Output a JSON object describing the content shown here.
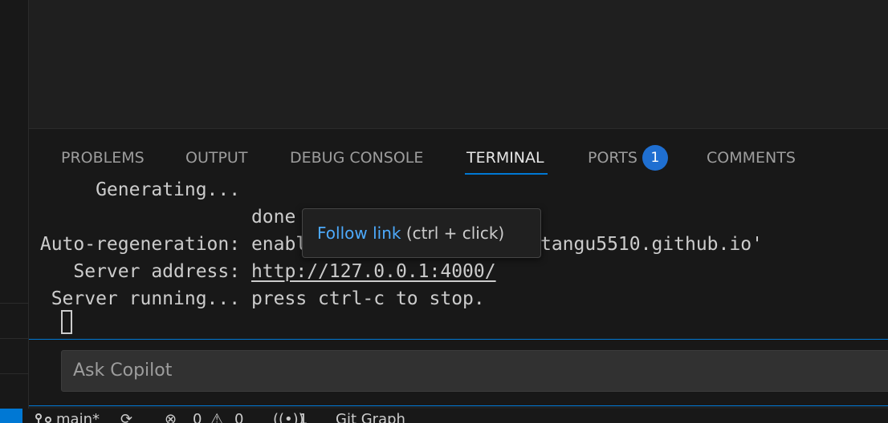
{
  "panel": {
    "tabs": [
      {
        "label": "PROBLEMS"
      },
      {
        "label": "OUTPUT"
      },
      {
        "label": "DEBUG CONSOLE"
      },
      {
        "label": "TERMINAL"
      },
      {
        "label": "PORTS",
        "badge": "1"
      },
      {
        "label": "COMMENTS"
      }
    ],
    "active_tab": "TERMINAL"
  },
  "terminal": {
    "line1": "      Generating...",
    "line2": "                    done in 0.350 seconds.",
    "line3_label": " Auto-regeneration: ",
    "line3_value": "enabled for '/workspaces/ttangu5510.github.io'",
    "line4_label": "    Server address: ",
    "line4_link": "http://127.0.0.1:4000/",
    "line5": "  Server running... press ctrl-c to stop."
  },
  "tooltip": {
    "link_text": "Follow link",
    "hint": " (ctrl + click)"
  },
  "copilot": {
    "placeholder": "Ask Copilot"
  },
  "statusbar": {
    "branch": "main*",
    "errors": "0",
    "warnings": "0",
    "ports": "1",
    "extra": "Git Graph"
  },
  "colors": {
    "accent": "#0078d4",
    "link": "#4daafc",
    "badge": "#1f6fd1"
  }
}
